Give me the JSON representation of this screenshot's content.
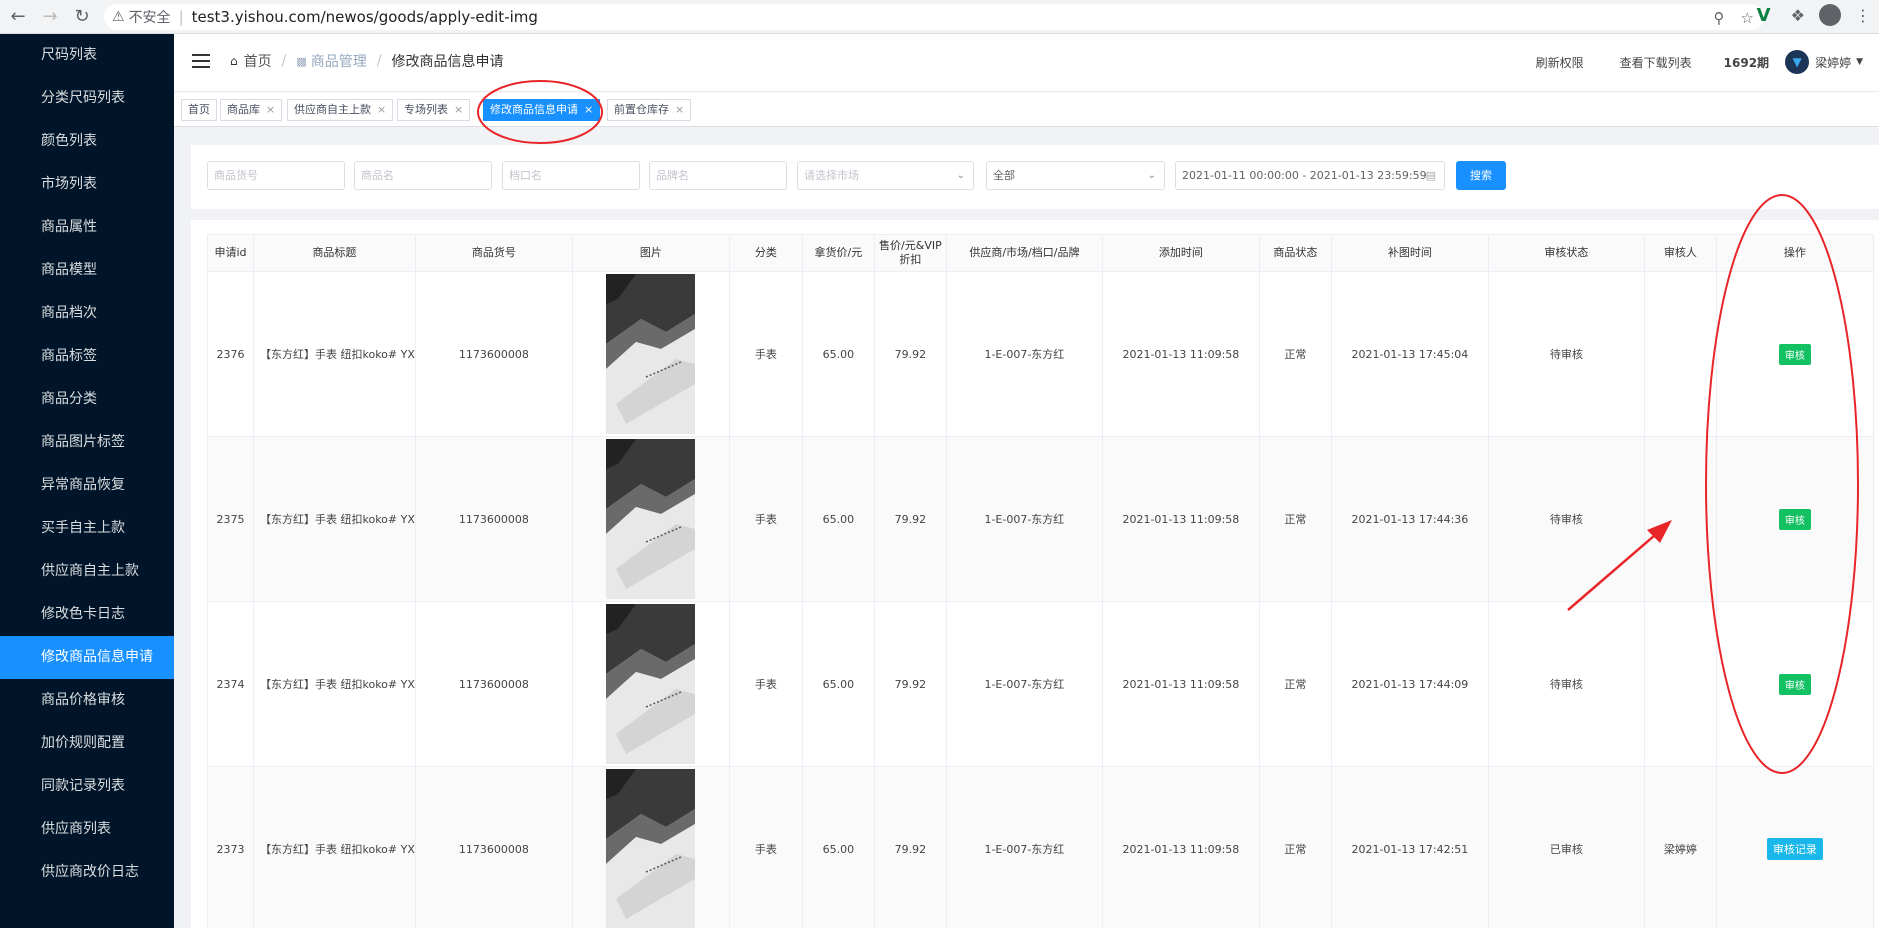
{
  "browser": {
    "security_label": "不安全",
    "url": "test3.yishou.com/newos/goods/apply-edit-img"
  },
  "sidebar": {
    "items": [
      {
        "label": "尺码列表"
      },
      {
        "label": "分类尺码列表"
      },
      {
        "label": "颜色列表"
      },
      {
        "label": "市场列表"
      },
      {
        "label": "商品属性"
      },
      {
        "label": "商品模型"
      },
      {
        "label": "商品档次"
      },
      {
        "label": "商品标签"
      },
      {
        "label": "商品分类"
      },
      {
        "label": "商品图片标签"
      },
      {
        "label": "异常商品恢复"
      },
      {
        "label": "买手自主上款"
      },
      {
        "label": "供应商自主上款"
      },
      {
        "label": "修改色卡日志"
      },
      {
        "label": "修改商品信息申请",
        "active": true
      },
      {
        "label": "商品价格审核"
      },
      {
        "label": "加价规则配置"
      },
      {
        "label": "同款记录列表"
      },
      {
        "label": "供应商列表"
      },
      {
        "label": "供应商改价日志"
      }
    ]
  },
  "header": {
    "breadcrumb": {
      "home": "首页",
      "section": "商品管理",
      "current": "修改商品信息申请"
    },
    "refresh_label": "刷新权限",
    "downloads_label": "查看下载列表",
    "period_label": "1692期",
    "user_name": "梁婷婷"
  },
  "tabs": [
    {
      "label": "首页",
      "closable": false
    },
    {
      "label": "商品库",
      "closable": true
    },
    {
      "label": "供应商自主上款",
      "closable": true
    },
    {
      "label": "专场列表",
      "closable": true
    },
    {
      "label": "修改商品信息申请",
      "closable": true,
      "active": true
    },
    {
      "label": "前置仓库存",
      "closable": true
    }
  ],
  "filters": {
    "goods_no_placeholder": "商品货号",
    "goods_name_placeholder": "商品名",
    "stall_placeholder": "档口名",
    "brand_placeholder": "品牌名",
    "market_placeholder": "请选择市场",
    "status_value": "全部",
    "date_range": "2021-01-11 00:00:00 - 2021-01-13 23:59:59",
    "search_label": "搜索"
  },
  "table": {
    "columns": [
      "申请id",
      "商品标题",
      "商品货号",
      "图片",
      "分类",
      "拿货价/元",
      "售价/元&VIP折扣",
      "供应商/市场/档口/品牌",
      "添加时间",
      "商品状态",
      "补图时间",
      "审核状态",
      "审核人",
      "操作"
    ],
    "rows": [
      {
        "id": "2376",
        "title": "【东方红】手表 纽扣koko# YX",
        "goods_no": "1173600008",
        "category": "手表",
        "cost": "65.00",
        "price": "79.92",
        "supplier": "1-E-007-东方红",
        "added": "2021-01-13 11:09:58",
        "status": "正常",
        "image_time": "2021-01-13 17:45:04",
        "review_status": "待审核",
        "reviewer": "",
        "action": "审核",
        "action_type": "review"
      },
      {
        "id": "2375",
        "title": "【东方红】手表 纽扣koko# YX",
        "goods_no": "1173600008",
        "category": "手表",
        "cost": "65.00",
        "price": "79.92",
        "supplier": "1-E-007-东方红",
        "added": "2021-01-13 11:09:58",
        "status": "正常",
        "image_time": "2021-01-13 17:44:36",
        "review_status": "待审核",
        "reviewer": "",
        "action": "审核",
        "action_type": "review"
      },
      {
        "id": "2374",
        "title": "【东方红】手表 纽扣koko# YX",
        "goods_no": "1173600008",
        "category": "手表",
        "cost": "65.00",
        "price": "79.92",
        "supplier": "1-E-007-东方红",
        "added": "2021-01-13 11:09:58",
        "status": "正常",
        "image_time": "2021-01-13 17:44:09",
        "review_status": "待审核",
        "reviewer": "",
        "action": "审核",
        "action_type": "review"
      },
      {
        "id": "2373",
        "title": "【东方红】手表 纽扣koko# YX",
        "goods_no": "1173600008",
        "category": "手表",
        "cost": "65.00",
        "price": "79.92",
        "supplier": "1-E-007-东方红",
        "added": "2021-01-13 11:09:58",
        "status": "正常",
        "image_time": "2021-01-13 17:42:51",
        "review_status": "已审核",
        "reviewer": "梁婷婷",
        "action": "审核记录",
        "action_type": "log"
      }
    ]
  },
  "colors": {
    "sidebar_bg": "#001529",
    "accent": "#1890ff",
    "review_button": "#13c163",
    "log_button": "#1ab7ea",
    "annotation": "#e8262a"
  }
}
